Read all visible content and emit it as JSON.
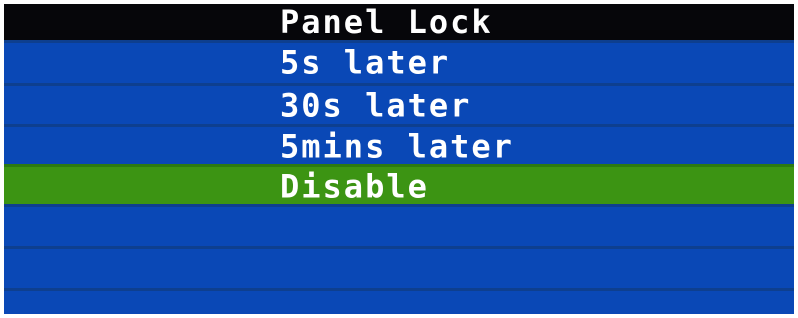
{
  "menu": {
    "title": "Panel Lock",
    "items": [
      {
        "label": "5s later",
        "selected": false
      },
      {
        "label": "30s later",
        "selected": false
      },
      {
        "label": "5mins later",
        "selected": false
      },
      {
        "label": "Disable",
        "selected": true
      }
    ]
  },
  "colors": {
    "background": "#0a48b6",
    "title_bar": "#06060a",
    "selected": "#3c9413",
    "text": "#ffffff"
  }
}
